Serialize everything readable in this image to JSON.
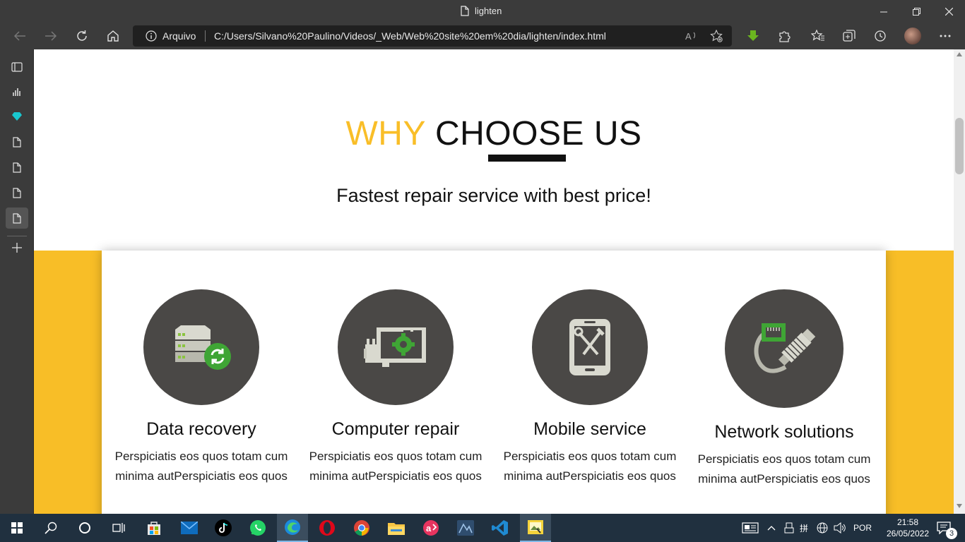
{
  "browser": {
    "tab_title": "lighten",
    "address": {
      "security_label": "Arquivo",
      "url": "C:/Users/Silvano%20Paulino/Videos/_Web/Web%20site%20em%20dia/lighten/index.html"
    }
  },
  "section": {
    "heading_accent": "WHY",
    "heading_rest": "CHOOSE US",
    "subheading": "Fastest repair service with best price!"
  },
  "services": [
    {
      "title": "Data recovery",
      "desc": "Perspiciatis eos quos totam cum minima autPerspiciatis eos quos"
    },
    {
      "title": "Computer repair",
      "desc": "Perspiciatis eos quos totam cum minima autPerspiciatis eos quos"
    },
    {
      "title": "Mobile service",
      "desc": "Perspiciatis eos quos totam cum minima autPerspiciatis eos quos"
    },
    {
      "title": "Network solutions",
      "desc": "Perspiciatis eos quos totam cum minima autPerspiciatis eos quos"
    }
  ],
  "taskbar": {
    "language": "POR",
    "time": "21:58",
    "date": "26/05/2022",
    "notification_count": "3"
  },
  "colors": {
    "accent_yellow": "#f8be27",
    "icon_circle": "#4a4846",
    "green": "#3fa535"
  }
}
